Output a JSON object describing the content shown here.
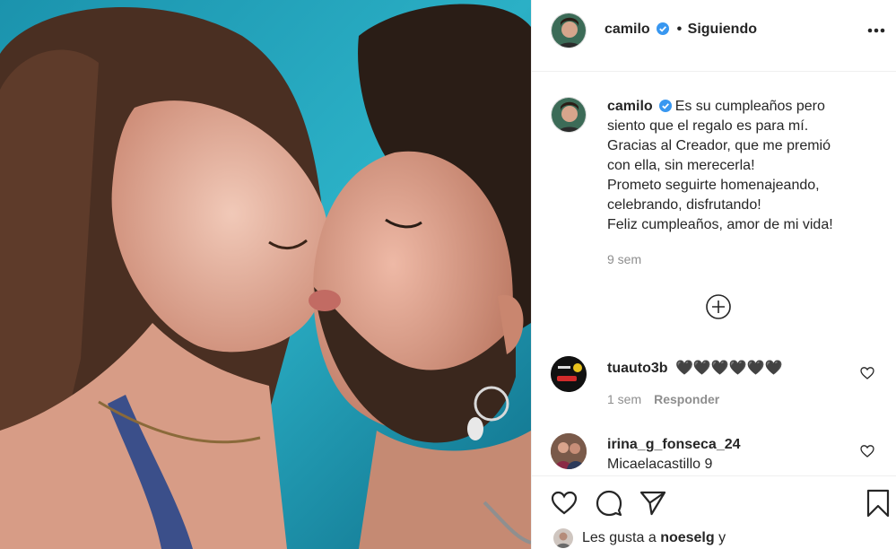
{
  "post": {
    "author": "camilo",
    "follow_sep": "•",
    "follow_status": "Siguiendo",
    "caption_lines": [
      "Es su cumpleaños pero",
      "siento que el regalo es para mí.",
      "Gracias al Creador, que me premió",
      "con ella, sin merecerla!",
      "Prometo seguirte homenajeando,",
      "celebrando, disfrutando!",
      "Feliz cumpleaños, amor de mi vida!"
    ],
    "caption_time": "9 sem"
  },
  "comments": [
    {
      "user": "tuauto3b",
      "text": "🖤🖤🖤🖤🖤🖤",
      "time": "1 sem",
      "reply_label": "Responder"
    },
    {
      "user": "irina_g_fonseca_24",
      "text": "Micaelacastillo 9"
    }
  ],
  "likes": {
    "prefix": "Les gusta a",
    "user": "noeselg",
    "suffix": "y"
  },
  "icons": {
    "verified": "verified-badge-icon",
    "more": "more-options-icon",
    "load_more": "plus-circle-icon",
    "like": "heart-icon",
    "comment": "comment-icon",
    "share": "paper-plane-icon",
    "save": "bookmark-icon"
  },
  "colors": {
    "verified_blue": "#3897f0",
    "muted_text": "#8e8e8e",
    "border": "#efefef"
  }
}
